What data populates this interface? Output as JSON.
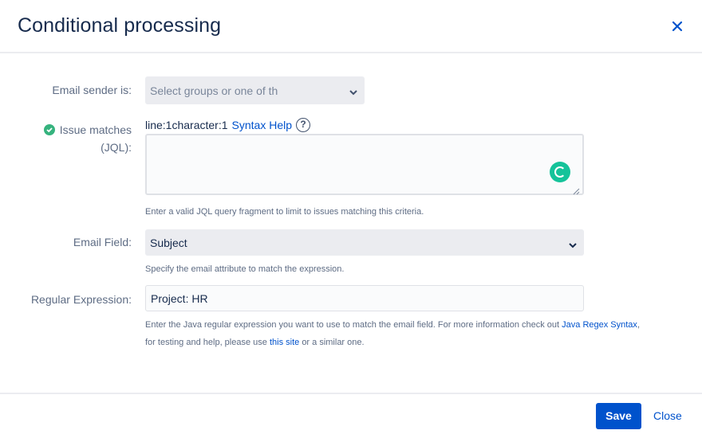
{
  "dialog": {
    "title": "Conditional processing",
    "close_icon": "close-icon"
  },
  "form": {
    "email_sender": {
      "label": "Email sender is:",
      "placeholder": "Select groups or one of th"
    },
    "jql": {
      "label_line1": "Issue matches",
      "label_line2": "(JQL):",
      "status_icon": "check-circle-icon",
      "position_text": "line:1character:1",
      "syntax_help_label": "Syntax Help",
      "help_icon": "?",
      "value": "",
      "help_text": "Enter a valid JQL query fragment to limit to issues matching this criteria."
    },
    "email_field": {
      "label": "Email Field:",
      "selected": "Subject",
      "help_text": "Specify the email attribute to match the expression."
    },
    "regex": {
      "label": "Regular Expression:",
      "value": "Project: HR",
      "help_text_part1": "Enter the Java regular expression you want to use to match the email field. For more information check out",
      "help_link1": "Java Regex Syntax",
      "help_text_part2": ",",
      "help_text_line2_part1": "for testing and help, please use",
      "help_link2": "this site",
      "help_text_line2_part2": "or a similar one."
    }
  },
  "footer": {
    "save_label": "Save",
    "close_label": "Close"
  },
  "colors": {
    "primary": "#0052cc",
    "success": "#36b37e",
    "grammarly": "#15c39a"
  }
}
